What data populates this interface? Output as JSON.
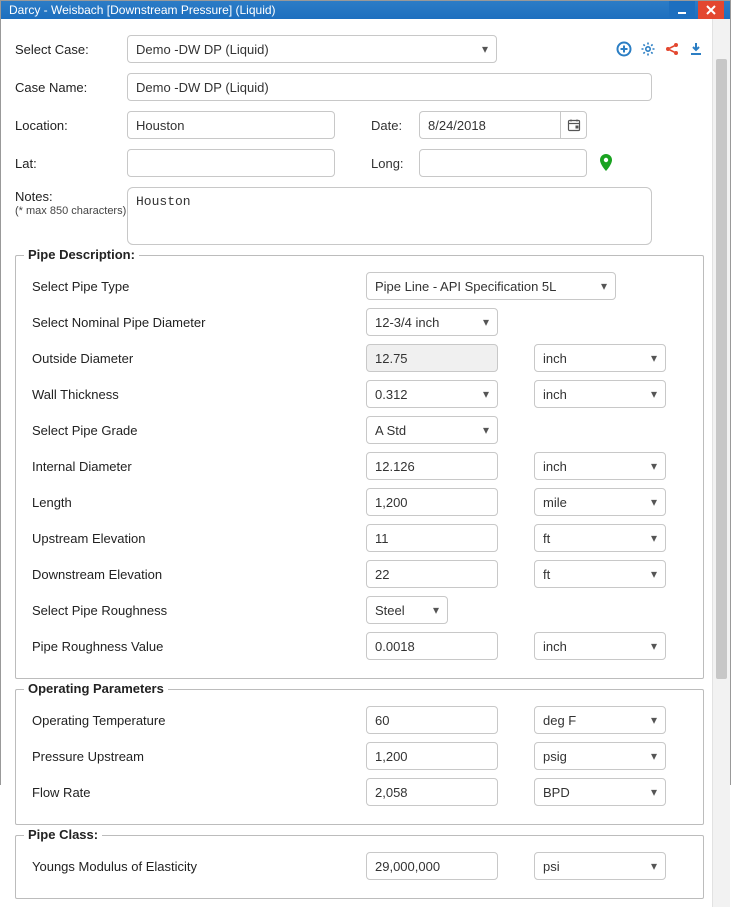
{
  "titlebar": {
    "title": "Darcy - Weisbach [Downstream Pressure] (Liquid)"
  },
  "header": {
    "selectCaseLabel": "Select Case:",
    "selectCaseValue": "Demo -DW DP (Liquid)",
    "caseNameLabel": "Case Name:",
    "caseNameValue": "Demo -DW DP (Liquid)",
    "locationLabel": "Location:",
    "locationValue": "Houston",
    "dateLabel": "Date:",
    "dateValue": "8/24/2018",
    "latLabel": "Lat:",
    "latValue": "",
    "longLabel": "Long:",
    "longValue": "",
    "notesLabel": "Notes:",
    "notesHint": "(* max 850 characters)",
    "notesValue": "Houston"
  },
  "pipeDesc": {
    "legend": "Pipe Description:",
    "pipeTypeLabel": "Select Pipe Type",
    "pipeTypeValue": "Pipe Line - API Specification 5L",
    "nominalDiaLabel": "Select Nominal Pipe Diameter",
    "nominalDiaValue": "12-3/4 inch",
    "odLabel": "Outside Diameter",
    "odValue": "12.75",
    "odUnit": "inch",
    "wallLabel": "Wall Thickness",
    "wallValue": "0.312",
    "wallUnit": "inch",
    "gradeLabel": "Select Pipe Grade",
    "gradeValue": "A Std",
    "idLabel": "Internal Diameter",
    "idValue": "12.126",
    "idUnit": "inch",
    "lengthLabel": "Length",
    "lengthValue": "1,200",
    "lengthUnit": "mile",
    "upElevLabel": "Upstream Elevation",
    "upElevValue": "11",
    "upElevUnit": "ft",
    "downElevLabel": "Downstream Elevation",
    "downElevValue": "22",
    "downElevUnit": "ft",
    "roughLabel": "Select Pipe Roughness",
    "roughValue": "Steel",
    "roughValLabel": "Pipe Roughness Value",
    "roughValValue": "0.0018",
    "roughValUnit": "inch"
  },
  "opParams": {
    "legend": "Operating Parameters",
    "tempLabel": "Operating Temperature",
    "tempValue": "60",
    "tempUnit": "deg F",
    "pUpLabel": "Pressure Upstream",
    "pUpValue": "1,200",
    "pUpUnit": "psig",
    "flowLabel": "Flow Rate",
    "flowValue": "2,058",
    "flowUnit": "BPD"
  },
  "pipeClass": {
    "legend": "Pipe Class:",
    "ymLabel": "Youngs Modulus of Elasticity",
    "ymValue": "29,000,000",
    "ymUnit": "psi"
  }
}
